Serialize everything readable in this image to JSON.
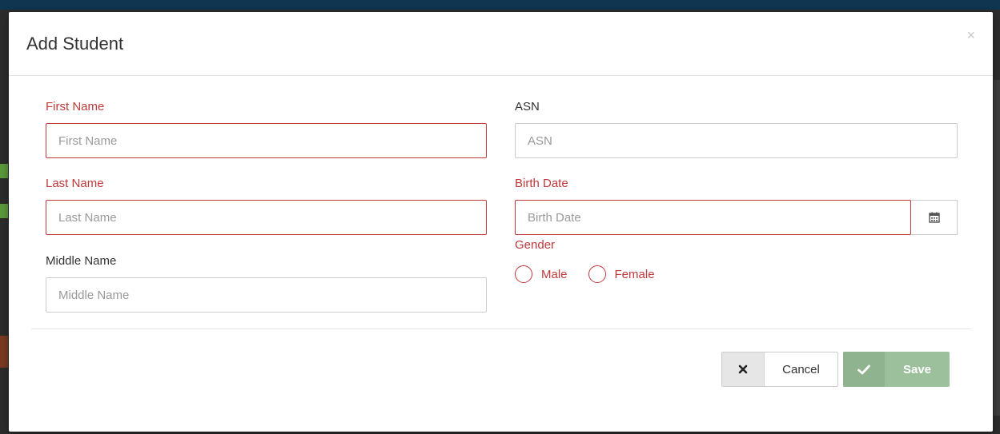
{
  "modal": {
    "title": "Add Student",
    "close_glyph": "×"
  },
  "form": {
    "first_name": {
      "label": "First Name",
      "placeholder": "First Name",
      "value": ""
    },
    "last_name": {
      "label": "Last Name",
      "placeholder": "Last Name",
      "value": ""
    },
    "middle_name": {
      "label": "Middle Name",
      "placeholder": "Middle Name",
      "value": ""
    },
    "asn": {
      "label": "ASN",
      "placeholder": "ASN",
      "value": ""
    },
    "birth_date": {
      "label": "Birth Date",
      "placeholder": "Birth Date",
      "value": "",
      "addon_icon": "calendar-icon"
    },
    "gender": {
      "label": "Gender",
      "options": [
        {
          "label": "Male",
          "selected": false
        },
        {
          "label": "Female",
          "selected": false
        }
      ]
    }
  },
  "footer": {
    "cancel_label": "Cancel",
    "cancel_icon": "times-icon",
    "save_label": "Save",
    "save_icon": "check-icon"
  },
  "colors": {
    "error": "#c0393b",
    "save_bg": "#9cbf9c",
    "header_bar": "#0f3550"
  }
}
